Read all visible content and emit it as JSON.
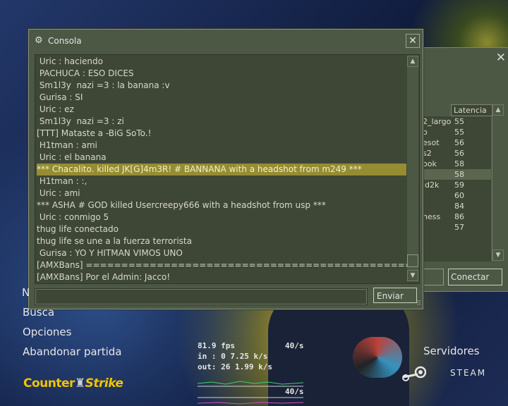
{
  "console": {
    "title": "Consola",
    "lines": [
      {
        "text": " Uric : haciendo",
        "highlight": false
      },
      {
        "text": " PACHUCA : ESO DICES",
        "highlight": false
      },
      {
        "text": " Sm1l3y  nazi =3 : la banana :v",
        "highlight": false
      },
      {
        "text": " Gurisa : SI",
        "highlight": false
      },
      {
        "text": " Uric : ez",
        "highlight": false
      },
      {
        "text": " Sm1l3y  nazi =3 : zi",
        "highlight": false
      },
      {
        "text": "[TTT] Mataste a -BiG SoTo.!",
        "highlight": false
      },
      {
        "text": " H1tman : ami",
        "highlight": false
      },
      {
        "text": " Uric : el banana",
        "highlight": false
      },
      {
        "text": "*** Chacalito. killed JK[G]4m3R! # BANNANA with a headshot from m249 ***",
        "highlight": true
      },
      {
        "text": " H1tman : :,",
        "highlight": false
      },
      {
        "text": " Uric : ami",
        "highlight": false
      },
      {
        "text": "*** ASHA # GOD killed Usercreepy666 with a headshot from usp ***",
        "highlight": false
      },
      {
        "text": " Uric : conmigo 5",
        "highlight": false
      },
      {
        "text": "thug life conectado",
        "highlight": false
      },
      {
        "text": "thug life se une a la fuerza terrorista",
        "highlight": false
      },
      {
        "text": " Gurisa : YO Y HITMAN VIMOS UNO",
        "highlight": false
      },
      {
        "text": "[AMXBans] ================================================",
        "highlight": false
      },
      {
        "text": "[AMXBans] Por el Admin: Jacco!",
        "highlight": false
      }
    ],
    "input_value": "",
    "send_label": "Enviar"
  },
  "server_browser": {
    "latency_header": "Latencia",
    "rows": [
      {
        "name": "2_largo",
        "latency": "55",
        "selected": false
      },
      {
        "name": "o",
        "latency": "55",
        "selected": false
      },
      {
        "name": "esot",
        "latency": "56",
        "selected": false
      },
      {
        "name": "s2",
        "latency": "56",
        "selected": false
      },
      {
        "name": "ook",
        "latency": "58",
        "selected": false
      },
      {
        "name": "",
        "latency": "58",
        "selected": true
      },
      {
        "name": "ld2k",
        "latency": "59",
        "selected": false
      },
      {
        "name": "",
        "latency": "60",
        "selected": false
      },
      {
        "name": "",
        "latency": "84",
        "selected": false
      },
      {
        "name": "ness",
        "latency": "86",
        "selected": false
      },
      {
        "name": "",
        "latency": "57",
        "selected": false
      }
    ],
    "connect_label": "Conectar"
  },
  "menu": {
    "partial": "N",
    "items": [
      "Busca",
      "Opciones",
      "Abandonar partida"
    ],
    "servers": "Servidores",
    "steam": "STEAM",
    "logo_left": "Counter",
    "logo_right": "Strike"
  },
  "netgraph": {
    "fps": "81.9 fps",
    "rate_top": "40/s",
    "in": "in :  0 7.25 k/s",
    "out": "out:  26 1.99 k/s",
    "rate_bottom": "40/s"
  },
  "colors": {
    "panel": "#4c5844",
    "panel_dark": "#3e4736",
    "highlight": "#958c33",
    "logo": "#f2c400"
  }
}
